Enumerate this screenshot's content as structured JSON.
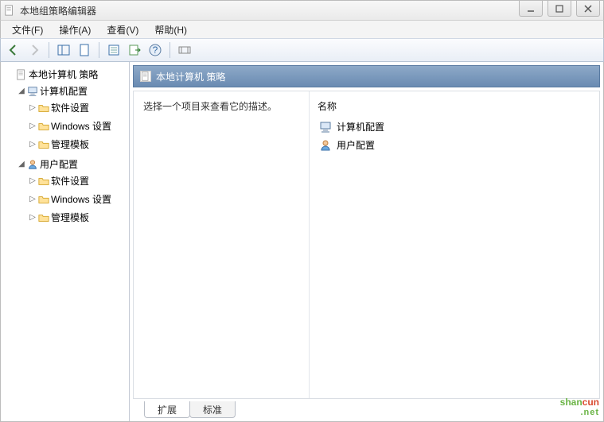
{
  "window": {
    "title": "本地组策略编辑器"
  },
  "menus": {
    "file": "文件(F)",
    "action": "操作(A)",
    "view": "查看(V)",
    "help": "帮助(H)"
  },
  "tree": {
    "root": {
      "label": "本地计算机 策略"
    },
    "computer": {
      "label": "计算机配置",
      "children": {
        "software": "软件设置",
        "windows": "Windows 设置",
        "templates": "管理模板"
      }
    },
    "user": {
      "label": "用户配置",
      "children": {
        "software": "软件设置",
        "windows": "Windows 设置",
        "templates": "管理模板"
      }
    }
  },
  "header": {
    "title": "本地计算机 策略"
  },
  "description": {
    "text": "选择一个项目来查看它的描述。"
  },
  "list": {
    "column_name": "名称",
    "items": [
      {
        "label": "计算机配置",
        "icon": "computer"
      },
      {
        "label": "用户配置",
        "icon": "user"
      }
    ]
  },
  "tabs": {
    "extended": "扩展",
    "standard": "标准"
  },
  "watermark": {
    "brand_a": "shan",
    "brand_b": "cun",
    "sub": ".net"
  }
}
